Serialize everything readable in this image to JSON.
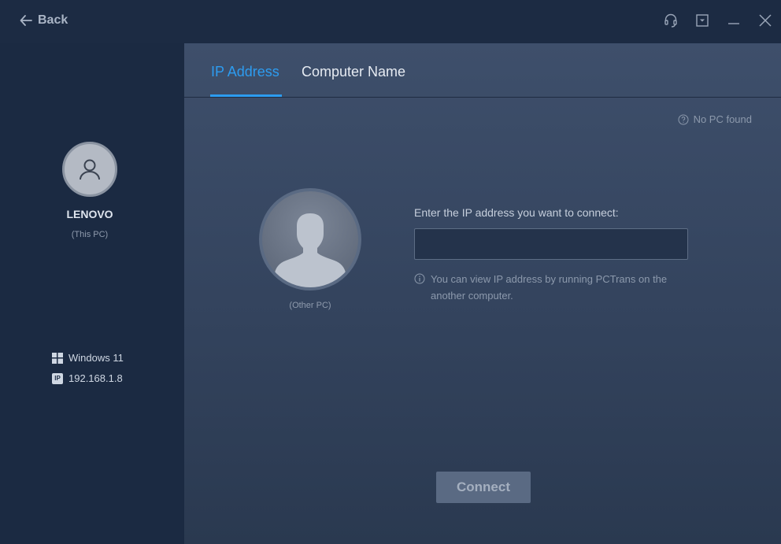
{
  "titlebar": {
    "back_label": "Back",
    "controls": [
      "headset-icon",
      "dropdown-icon",
      "minimize-icon",
      "close-icon"
    ]
  },
  "this_pc": {
    "name": "LENOVO",
    "sub": "(This PC)",
    "os": "Windows 11",
    "ip_badge": "IP",
    "ip": "192.168.1.8"
  },
  "tabs": [
    {
      "label": "IP Address",
      "active": true
    },
    {
      "label": "Computer Name",
      "active": false
    }
  ],
  "status": {
    "no_pc": "No PC found"
  },
  "other_pc": {
    "label": "(Other PC)"
  },
  "form": {
    "ip_label": "Enter the IP address you want to connect:",
    "ip_value": "",
    "hint": "You can view IP address by running PCTrans on the another computer."
  },
  "actions": {
    "connect": "Connect"
  },
  "colors": {
    "accent": "#2d9cf0",
    "sidebar_bg": "#1b2a42",
    "main_bg": "#3a4a65"
  }
}
